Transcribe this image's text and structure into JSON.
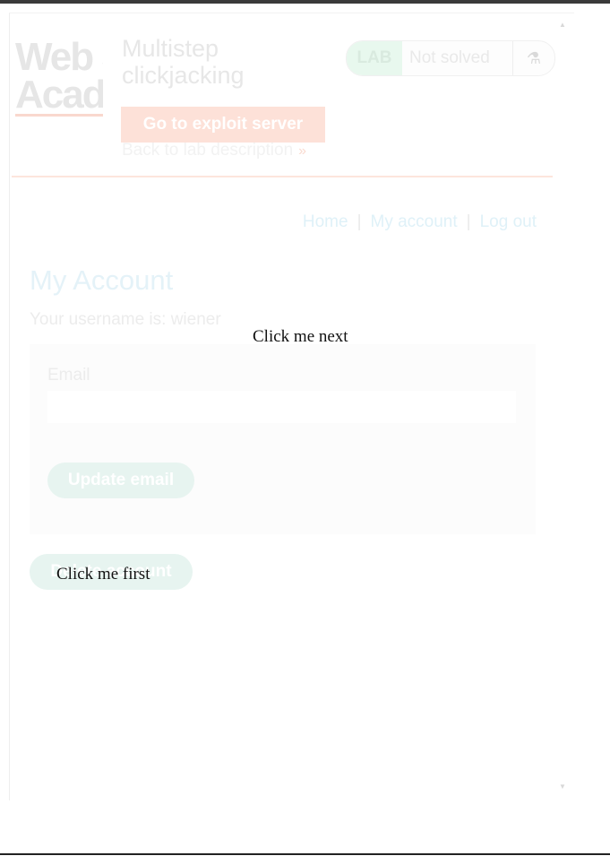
{
  "lab": {
    "logo_lines": [
      "Web Security",
      "Academy"
    ],
    "title_lines": [
      "Multistep",
      "clickjacking"
    ],
    "exploit_button": "Go to exploit server",
    "back_link": "Back to lab description",
    "back_link_icon": "double-chevron-right-icon",
    "status_badge": "LAB",
    "status_text": "Not solved",
    "status_icon": "flask-icon"
  },
  "nav": {
    "home": "Home",
    "separator": "|",
    "my_account": "My account",
    "logout": "Log out"
  },
  "account": {
    "heading": "My Account",
    "username_line": "Your username is: wiener",
    "email_label": "Email",
    "email_value": "",
    "update_button": "Update email",
    "delete_button": "Delete account"
  },
  "decoys": {
    "next": "Click me next",
    "first": "Click me first"
  },
  "colors": {
    "lab_accent": "#fde1d8",
    "link": "#dff1f8",
    "button": "#e7f4f0",
    "badge": "#e8f8ee"
  }
}
